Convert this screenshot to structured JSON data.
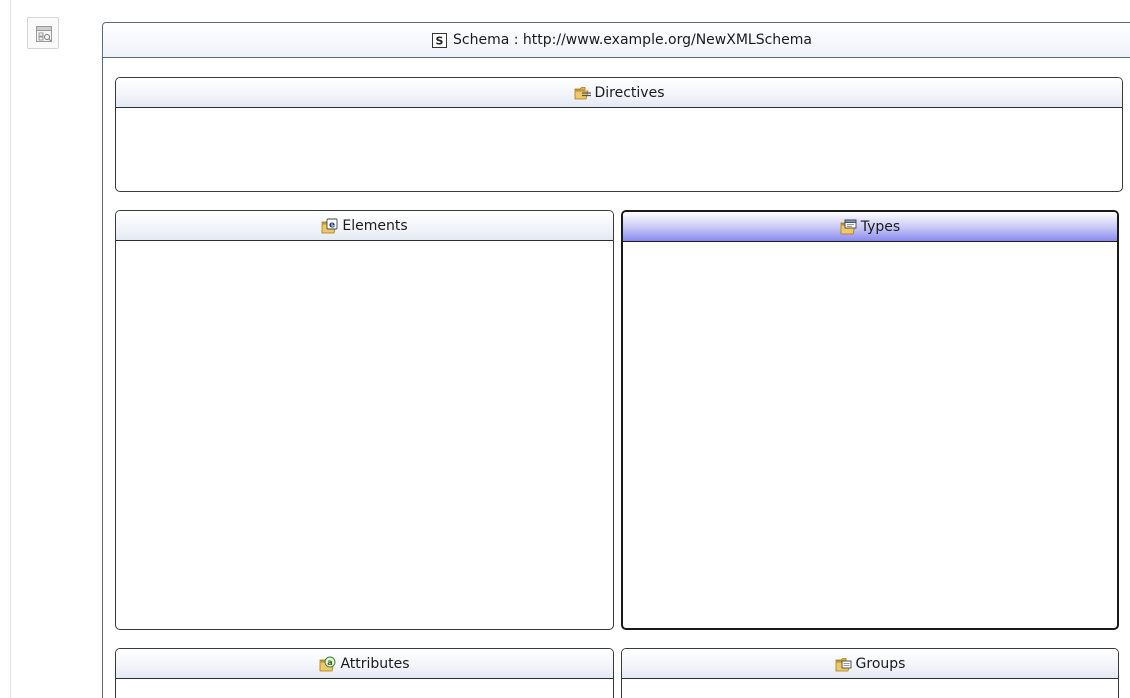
{
  "sidebar": {
    "overview_icon": "overview-icon"
  },
  "schema": {
    "icon": "schema-icon",
    "icon_letter": "S",
    "title": "Schema : http://www.example.org/NewXMLSchema"
  },
  "categories": {
    "directives": {
      "label": "Directives",
      "icon": "directives-folder-icon"
    },
    "elements": {
      "label": "Elements",
      "icon": "elements-folder-icon",
      "icon_letter": "e"
    },
    "types": {
      "label": "Types",
      "icon": "types-folder-icon",
      "selected": true
    },
    "attributes": {
      "label": "Attributes",
      "icon": "attributes-folder-icon",
      "icon_letter": "a"
    },
    "groups": {
      "label": "Groups",
      "icon": "groups-folder-icon"
    }
  },
  "colors": {
    "frame_border": "#5f6a79",
    "selected_header": "#8a8af0",
    "folder": "#f2c866"
  }
}
